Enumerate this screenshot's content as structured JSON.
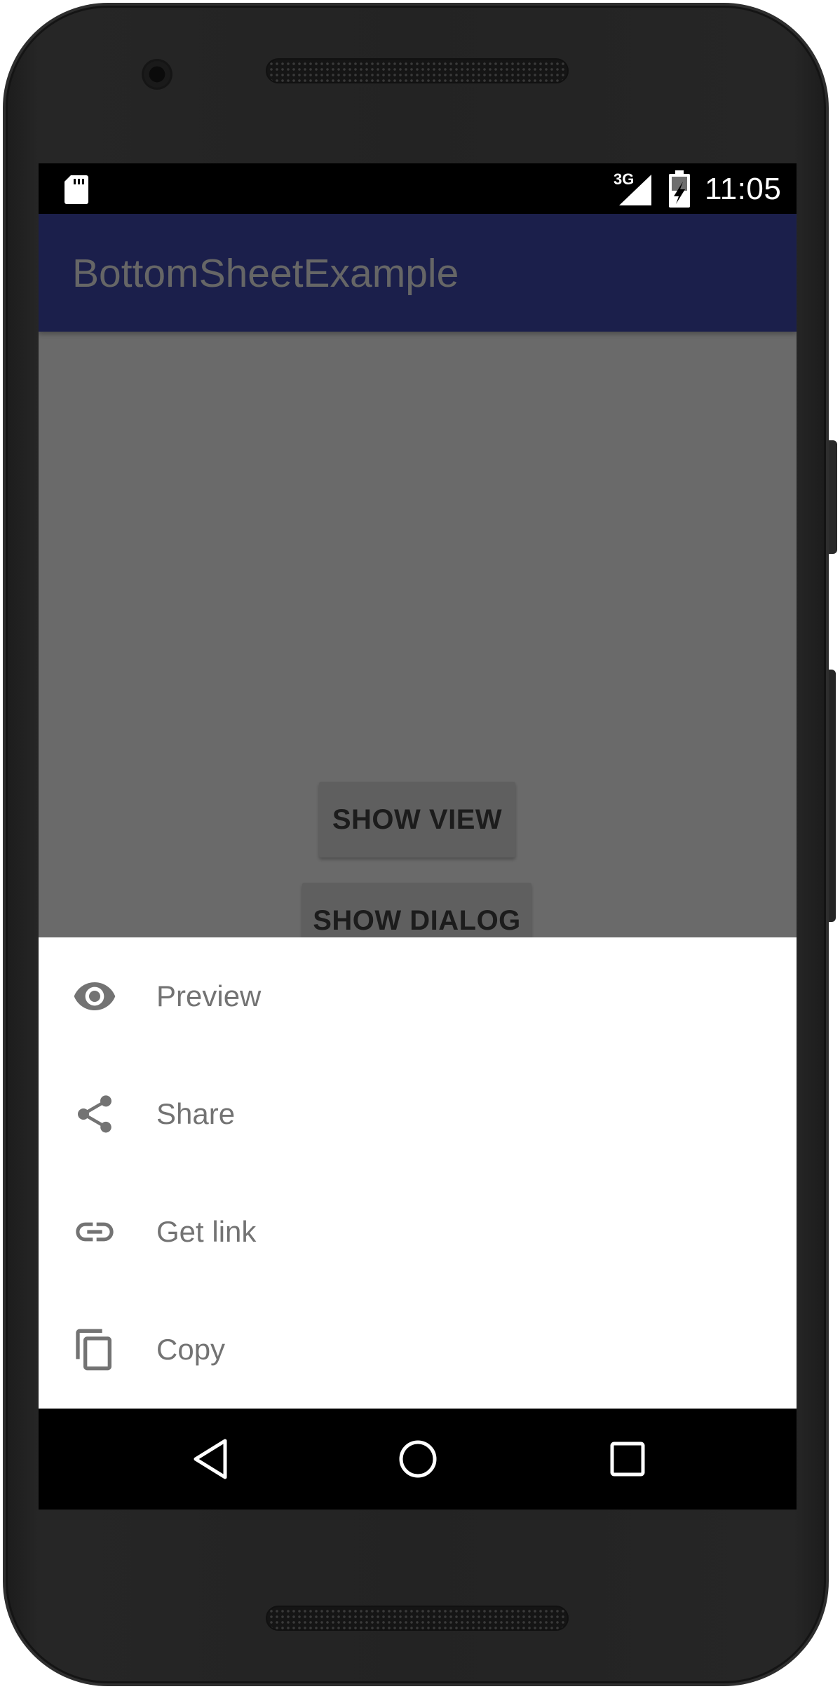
{
  "status_bar": {
    "network_label": "3G",
    "time": "11:05",
    "icons": [
      "sd-card-icon",
      "signal-icon",
      "battery-icon"
    ]
  },
  "app_bar": {
    "title": "BottomSheetExample",
    "color": "#1b1f4b"
  },
  "content": {
    "show_view_label": "SHOW VIEW",
    "show_dialog_label": "SHOW DIALOG",
    "scrim_color": "#6a6a6a"
  },
  "bottom_sheet": {
    "items": [
      {
        "label": "Preview",
        "icon": "eye-icon"
      },
      {
        "label": "Share",
        "icon": "share-icon"
      },
      {
        "label": "Get link",
        "icon": "link-icon"
      },
      {
        "label": "Copy",
        "icon": "copy-icon"
      }
    ],
    "text_color": "#737373"
  },
  "nav_bar": {
    "buttons": [
      "back-icon",
      "home-icon",
      "recents-icon"
    ]
  }
}
